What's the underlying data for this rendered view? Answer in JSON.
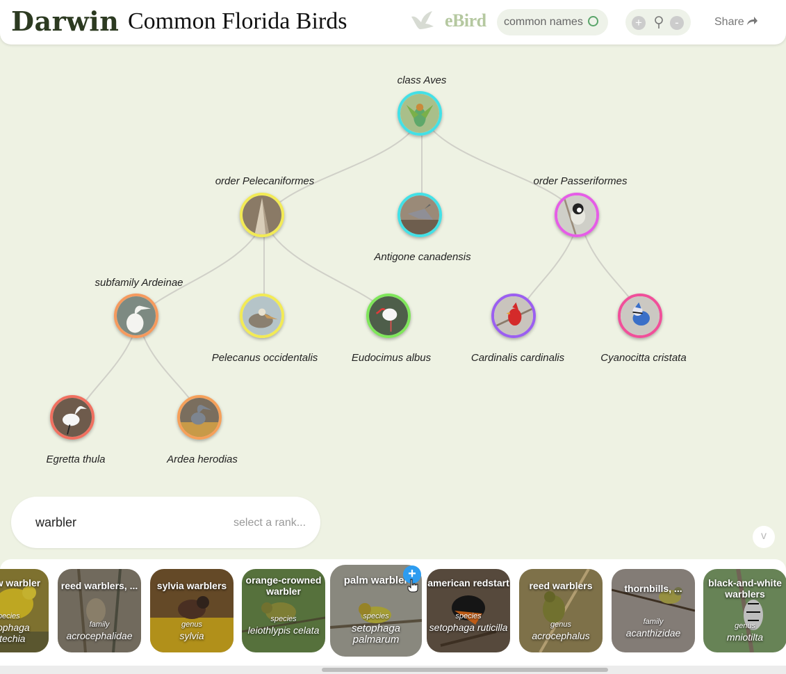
{
  "app": {
    "logo": "Darwin",
    "title": "Common Florida Birds"
  },
  "header": {
    "ebird_label": "eBird",
    "toggle_label": "common names",
    "zoom_in": "+",
    "zoom_out": "-",
    "share_label": "Share"
  },
  "tree": {
    "nodes": [
      {
        "label": "class Aves",
        "color": "#43e0e6"
      },
      {
        "label": "order Pelecaniformes",
        "color": "#f2ea55"
      },
      {
        "label": "Antigone canadensis",
        "color": "#43e0e6"
      },
      {
        "label": "order Passeriformes",
        "color": "#e55de6"
      },
      {
        "label": "subfamily Ardeinae",
        "color": "#f59a5e"
      },
      {
        "label": "Pelecanus occidentalis",
        "color": "#f2ea55"
      },
      {
        "label": "Eudocimus albus",
        "color": "#7fe65a"
      },
      {
        "label": "Cardinalis cardinalis",
        "color": "#9b5ff0"
      },
      {
        "label": "Cyanocitta cristata",
        "color": "#f0509a"
      },
      {
        "label": "Egretta thula",
        "color": "#f07060"
      },
      {
        "label": "Ardea herodias",
        "color": "#f5a05a"
      }
    ]
  },
  "search": {
    "query": "warbler",
    "rank_placeholder": "select a rank..."
  },
  "collapse_label": "v",
  "results": [
    {
      "name": "yellow warbler",
      "rank": "species",
      "scientific": "setophaga petechia"
    },
    {
      "name": "reed warblers, ...",
      "rank": "family",
      "scientific": "acrocephalidae"
    },
    {
      "name": "sylvia warblers",
      "rank": "genus",
      "scientific": "sylvia"
    },
    {
      "name": "orange-crowned warbler",
      "rank": "species",
      "scientific": "leiothlypis celata"
    },
    {
      "name": "palm warbler",
      "rank": "species",
      "scientific": "setophaga palmarum"
    },
    {
      "name": "american redstart",
      "rank": "species",
      "scientific": "setophaga ruticilla"
    },
    {
      "name": "reed warblers",
      "rank": "genus",
      "scientific": "acrocephalus"
    },
    {
      "name": "thornbills, ...",
      "rank": "family",
      "scientific": "acanthizidae"
    },
    {
      "name": "black-and-white warblers",
      "rank": "genus",
      "scientific": "mniotilta"
    }
  ],
  "add_label": "+"
}
